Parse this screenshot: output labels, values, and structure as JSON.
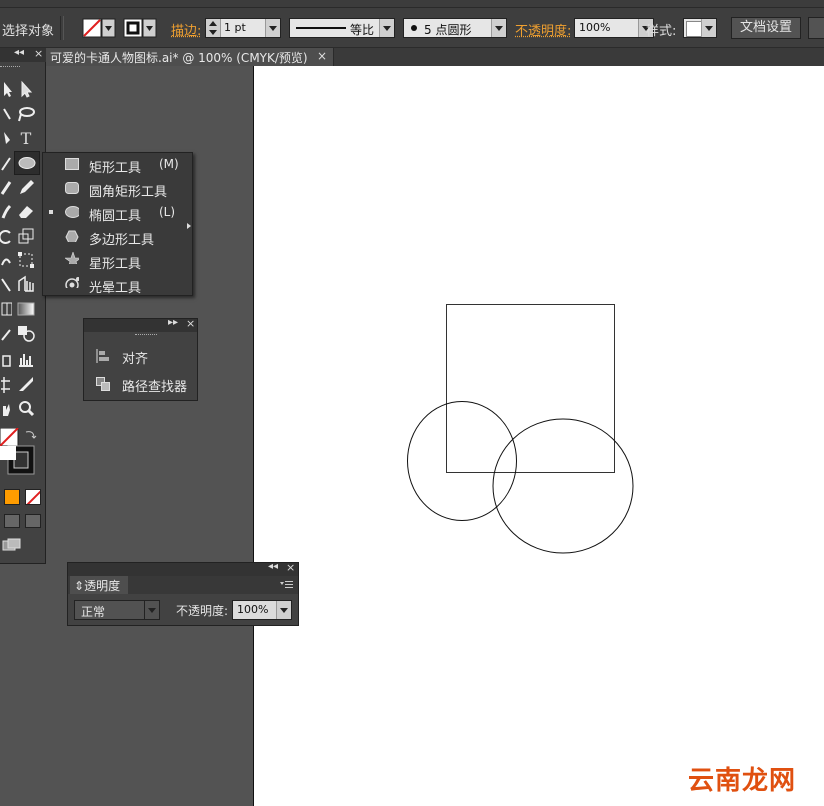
{
  "control_bar": {
    "selection_label": "选择对象",
    "stroke_label": "描边:",
    "stroke_weight": "1 pt",
    "profile_label": "等比",
    "brush_label": "5 点圆形",
    "opacity_label": "不透明度:",
    "opacity_value": "100%",
    "style_label": "样式:",
    "doc_setup_label": "文档设置"
  },
  "document_tab": {
    "title": "可爱的卡通人物图标.ai* @ 100% (CMYK/预览)",
    "close": "×"
  },
  "tools_panel": {
    "collapse": "◂◂",
    "close": "×",
    "type_tool_glyph": "T"
  },
  "shape_flyout": {
    "items": [
      {
        "label": "矩形工具",
        "shortcut": "(M)",
        "icon": "rectangle-icon"
      },
      {
        "label": "圆角矩形工具",
        "shortcut": "",
        "icon": "rounded-rectangle-icon"
      },
      {
        "label": "椭圆工具",
        "shortcut": "(L)",
        "icon": "ellipse-icon"
      },
      {
        "label": "多边形工具",
        "shortcut": "",
        "icon": "polygon-icon"
      },
      {
        "label": "星形工具",
        "shortcut": "",
        "icon": "star-icon"
      },
      {
        "label": "光晕工具",
        "shortcut": "",
        "icon": "flare-icon"
      }
    ]
  },
  "align_panel": {
    "expand": "▸▸",
    "close": "×",
    "items": [
      {
        "label": "对齐",
        "icon": "align-icon"
      },
      {
        "label": "路径查找器",
        "icon": "pathfinder-icon"
      }
    ]
  },
  "transparency_panel": {
    "collapse": "◂◂",
    "close": "×",
    "tab_label": "透明度",
    "blend_mode": "正常",
    "opacity_label": "不透明度:",
    "opacity_value": "100%"
  },
  "watermark": "云南龙网",
  "colors": {
    "ui_dark": "#535353",
    "panel": "#424242",
    "accent_orange": "#f0a030",
    "artboard": "#ffffff"
  }
}
